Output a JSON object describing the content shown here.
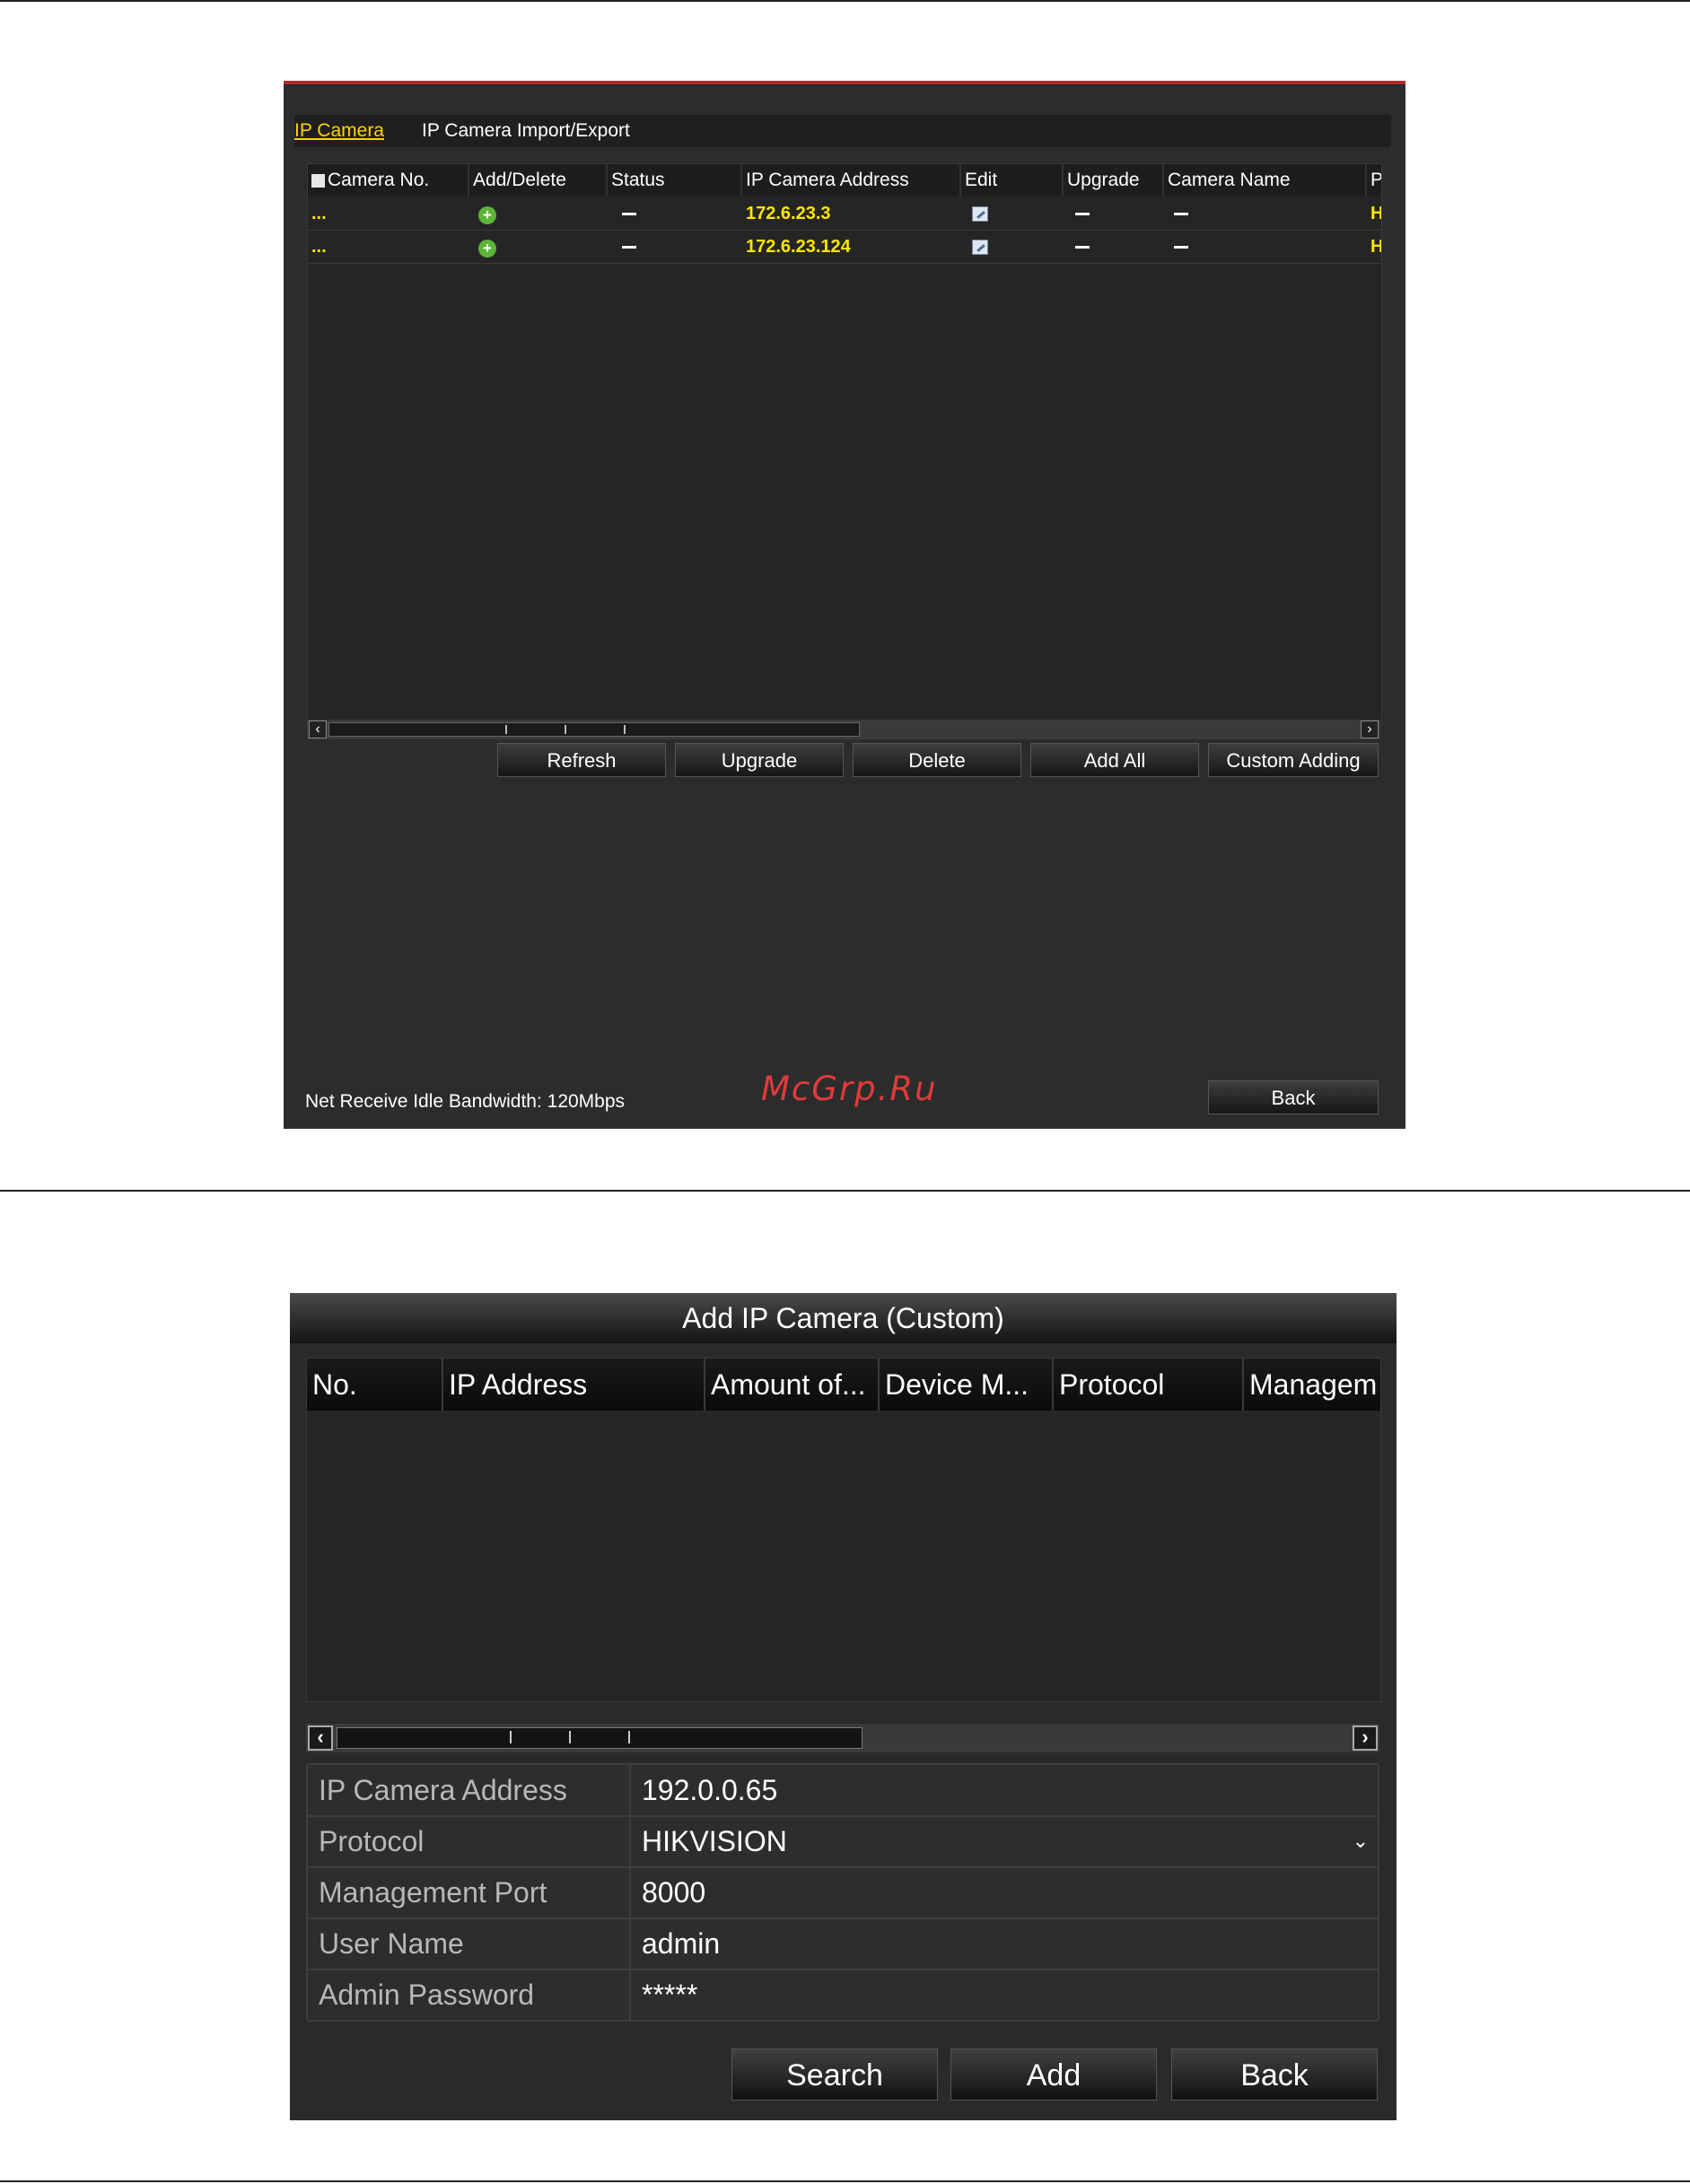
{
  "camera_panel": {
    "tabs": [
      "IP Camera",
      "IP Camera Import/Export"
    ],
    "table": {
      "columns": [
        "Camera No.",
        "Add/Delete",
        "Status",
        "IP Camera Address",
        "Edit",
        "Upgrade",
        "Camera Name",
        "P"
      ],
      "rows": [
        {
          "camera_no": "...",
          "status": "—",
          "ip": "172.6.23.3",
          "upgrade": "—",
          "camera_name": "—",
          "protocol": "H"
        },
        {
          "camera_no": "...",
          "status": "—",
          "ip": "172.6.23.124",
          "upgrade": "—",
          "camera_name": "—",
          "protocol": "H"
        }
      ]
    },
    "buttons": {
      "refresh": "Refresh",
      "upgrade": "Upgrade",
      "delete": "Delete",
      "add_all": "Add All",
      "custom_adding": "Custom Adding",
      "back": "Back"
    },
    "bandwidth_text": "Net Receive Idle Bandwidth: 120Mbps"
  },
  "watermark": "McGrp.Ru",
  "add_dialog": {
    "title": "Add IP Camera (Custom)",
    "columns": [
      "No.",
      "IP Address",
      "Amount of...",
      "Device M...",
      "Protocol",
      "Managem"
    ],
    "fields": [
      {
        "label": "IP Camera Address",
        "value": "192.0.0.65"
      },
      {
        "label": "Protocol",
        "value": "HIKVISION"
      },
      {
        "label": "Management Port",
        "value": "8000"
      },
      {
        "label": "User Name",
        "value": "admin"
      },
      {
        "label": "Admin Password",
        "value": "*****"
      }
    ],
    "buttons": {
      "search": "Search",
      "add": "Add",
      "back": "Back"
    }
  },
  "colors": {
    "highlight_text": "#ffe600",
    "accent_red": "#b22a2a",
    "add_icon": "#5fb339",
    "watermark": "#e03a3a"
  },
  "icons": {
    "add": "add-circle-icon",
    "edit": "edit-icon",
    "scroll_left": "chevron-left-icon",
    "scroll_right": "chevron-right-icon",
    "dropdown": "chevron-down-icon"
  }
}
